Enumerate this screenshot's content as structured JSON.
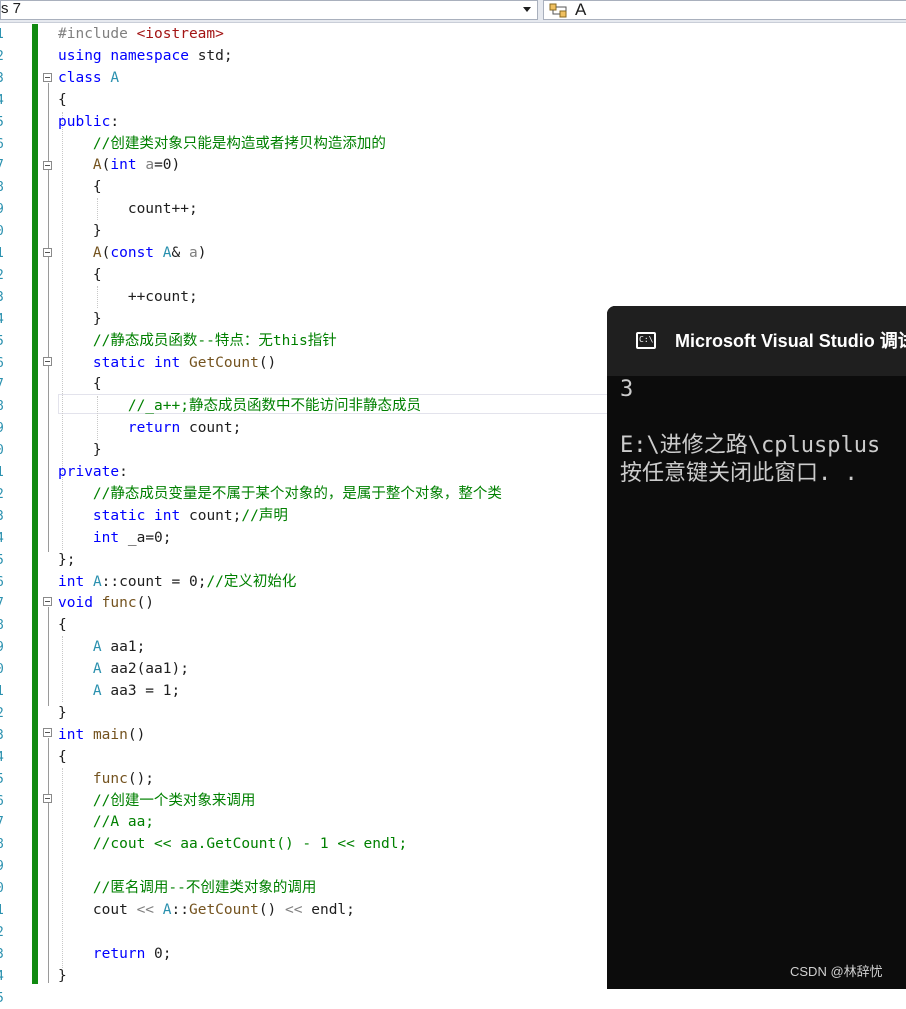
{
  "toolbar": {
    "scope_dropdown_value": "s 7",
    "member_dropdown_value": "A",
    "member_icon": "class-icon"
  },
  "editor": {
    "line_numbers": [
      "1",
      "2",
      "3",
      "4",
      "5",
      "6",
      "7",
      "8",
      "9",
      "0",
      "1",
      "2",
      "3",
      "4",
      "5",
      "6",
      "7",
      "8",
      "9",
      "0",
      "1",
      "2",
      "3",
      "4",
      "5",
      "6",
      "7",
      "8",
      "9",
      "0",
      "1",
      "2",
      "3",
      "4",
      "5",
      "6",
      "7",
      "8",
      "9",
      "0",
      "1",
      "2",
      "3",
      "4",
      "5"
    ],
    "lines": [
      [
        {
          "t": "#include ",
          "c": "pp"
        },
        {
          "t": "<iostream>",
          "c": "st"
        }
      ],
      [
        {
          "t": "using",
          "c": "kw"
        },
        {
          "t": " ",
          "c": "id"
        },
        {
          "t": "namespace",
          "c": "kw"
        },
        {
          "t": " std;",
          "c": "id"
        }
      ],
      [
        {
          "t": "class",
          "c": "kw"
        },
        {
          "t": " ",
          "c": "id"
        },
        {
          "t": "A",
          "c": "ty"
        }
      ],
      [
        {
          "t": "{",
          "c": "id"
        }
      ],
      [
        {
          "t": "public",
          "c": "kw"
        },
        {
          "t": ":",
          "c": "id"
        }
      ],
      [
        {
          "t": "    ",
          "c": "id"
        },
        {
          "t": "//创建类对象只能是构造或者拷贝构造添加的",
          "c": "cm"
        }
      ],
      [
        {
          "t": "    ",
          "c": "id"
        },
        {
          "t": "A",
          "c": "fn"
        },
        {
          "t": "(",
          "c": "id"
        },
        {
          "t": "int",
          "c": "kw"
        },
        {
          "t": " ",
          "c": "id"
        },
        {
          "t": "a",
          "c": "pm"
        },
        {
          "t": "=0)",
          "c": "id"
        }
      ],
      [
        {
          "t": "    {",
          "c": "id"
        }
      ],
      [
        {
          "t": "        count++;",
          "c": "id"
        }
      ],
      [
        {
          "t": "    }",
          "c": "id"
        }
      ],
      [
        {
          "t": "    ",
          "c": "id"
        },
        {
          "t": "A",
          "c": "fn"
        },
        {
          "t": "(",
          "c": "id"
        },
        {
          "t": "const",
          "c": "kw"
        },
        {
          "t": " ",
          "c": "id"
        },
        {
          "t": "A",
          "c": "ty"
        },
        {
          "t": "& ",
          "c": "id"
        },
        {
          "t": "a",
          "c": "pm"
        },
        {
          "t": ")",
          "c": "id"
        }
      ],
      [
        {
          "t": "    {",
          "c": "id"
        }
      ],
      [
        {
          "t": "        ++count;",
          "c": "id"
        }
      ],
      [
        {
          "t": "    }",
          "c": "id"
        }
      ],
      [
        {
          "t": "    ",
          "c": "id"
        },
        {
          "t": "//静态成员函数--特点：无this指针",
          "c": "cm"
        }
      ],
      [
        {
          "t": "    ",
          "c": "id"
        },
        {
          "t": "static",
          "c": "kw"
        },
        {
          "t": " ",
          "c": "id"
        },
        {
          "t": "int",
          "c": "kw"
        },
        {
          "t": " ",
          "c": "id"
        },
        {
          "t": "GetCount",
          "c": "fn"
        },
        {
          "t": "()",
          "c": "id"
        }
      ],
      [
        {
          "t": "    {",
          "c": "id"
        }
      ],
      [
        {
          "t": "        ",
          "c": "id"
        },
        {
          "t": "//_a++;静态成员函数中不能访问非静态成员",
          "c": "cm"
        }
      ],
      [
        {
          "t": "        ",
          "c": "id"
        },
        {
          "t": "return",
          "c": "kw"
        },
        {
          "t": " count;",
          "c": "id"
        }
      ],
      [
        {
          "t": "    }",
          "c": "id"
        }
      ],
      [
        {
          "t": "private",
          "c": "kw"
        },
        {
          "t": ":",
          "c": "id"
        }
      ],
      [
        {
          "t": "    ",
          "c": "id"
        },
        {
          "t": "//静态成员变量是不属于某个对象的，是属于整个对象，整个类",
          "c": "cm"
        }
      ],
      [
        {
          "t": "    ",
          "c": "id"
        },
        {
          "t": "static",
          "c": "kw"
        },
        {
          "t": " ",
          "c": "id"
        },
        {
          "t": "int",
          "c": "kw"
        },
        {
          "t": " count;",
          "c": "id"
        },
        {
          "t": "//声明",
          "c": "cm"
        }
      ],
      [
        {
          "t": "    ",
          "c": "id"
        },
        {
          "t": "int",
          "c": "kw"
        },
        {
          "t": " _a=0;",
          "c": "id"
        }
      ],
      [
        {
          "t": "};",
          "c": "id"
        }
      ],
      [
        {
          "t": "int",
          "c": "kw"
        },
        {
          "t": " ",
          "c": "id"
        },
        {
          "t": "A",
          "c": "ty"
        },
        {
          "t": "::count = 0;",
          "c": "id"
        },
        {
          "t": "//定义初始化",
          "c": "cm"
        }
      ],
      [
        {
          "t": "void",
          "c": "kw"
        },
        {
          "t": " ",
          "c": "id"
        },
        {
          "t": "func",
          "c": "fn"
        },
        {
          "t": "()",
          "c": "id"
        }
      ],
      [
        {
          "t": "{",
          "c": "id"
        }
      ],
      [
        {
          "t": "    ",
          "c": "id"
        },
        {
          "t": "A",
          "c": "ty"
        },
        {
          "t": " aa1;",
          "c": "id"
        }
      ],
      [
        {
          "t": "    ",
          "c": "id"
        },
        {
          "t": "A",
          "c": "ty"
        },
        {
          "t": " aa2(aa1);",
          "c": "id"
        }
      ],
      [
        {
          "t": "    ",
          "c": "id"
        },
        {
          "t": "A",
          "c": "ty"
        },
        {
          "t": " aa3 = 1;",
          "c": "id"
        }
      ],
      [
        {
          "t": "}",
          "c": "id"
        }
      ],
      [
        {
          "t": "int",
          "c": "kw"
        },
        {
          "t": " ",
          "c": "id"
        },
        {
          "t": "main",
          "c": "fn"
        },
        {
          "t": "()",
          "c": "id"
        }
      ],
      [
        {
          "t": "{",
          "c": "id"
        }
      ],
      [
        {
          "t": "    ",
          "c": "id"
        },
        {
          "t": "func",
          "c": "fn"
        },
        {
          "t": "();",
          "c": "id"
        }
      ],
      [
        {
          "t": "    ",
          "c": "id"
        },
        {
          "t": "//创建一个类对象来调用",
          "c": "cm"
        }
      ],
      [
        {
          "t": "    ",
          "c": "id"
        },
        {
          "t": "//A aa;",
          "c": "cm"
        }
      ],
      [
        {
          "t": "    ",
          "c": "id"
        },
        {
          "t": "//cout << aa.GetCount() - 1 << endl;",
          "c": "cm"
        }
      ],
      [
        {
          "t": "",
          "c": "id"
        }
      ],
      [
        {
          "t": "    ",
          "c": "id"
        },
        {
          "t": "//匿名调用--不创建类对象的调用",
          "c": "cm"
        }
      ],
      [
        {
          "t": "    cout ",
          "c": "id"
        },
        {
          "t": "<<",
          "c": "pp"
        },
        {
          "t": " ",
          "c": "id"
        },
        {
          "t": "A",
          "c": "ty"
        },
        {
          "t": "::",
          "c": "id"
        },
        {
          "t": "GetCount",
          "c": "fn"
        },
        {
          "t": "() ",
          "c": "id"
        },
        {
          "t": "<<",
          "c": "pp"
        },
        {
          "t": " endl;",
          "c": "id"
        }
      ],
      [
        {
          "t": "",
          "c": "id"
        }
      ],
      [
        {
          "t": "    ",
          "c": "id"
        },
        {
          "t": "return",
          "c": "kw"
        },
        {
          "t": " 0;",
          "c": "id"
        }
      ],
      [
        {
          "t": "}",
          "c": "id"
        }
      ]
    ]
  },
  "console": {
    "icon": "console-icon",
    "icon_glyph": "C:\\",
    "title": "Microsoft Visual Studio 调试",
    "output_line1": "3",
    "output_line2": "",
    "output_line3": "E:\\进修之路\\cplusplus",
    "output_line4": "按任意键关闭此窗口. ."
  },
  "watermark": "CSDN @林辞忧"
}
